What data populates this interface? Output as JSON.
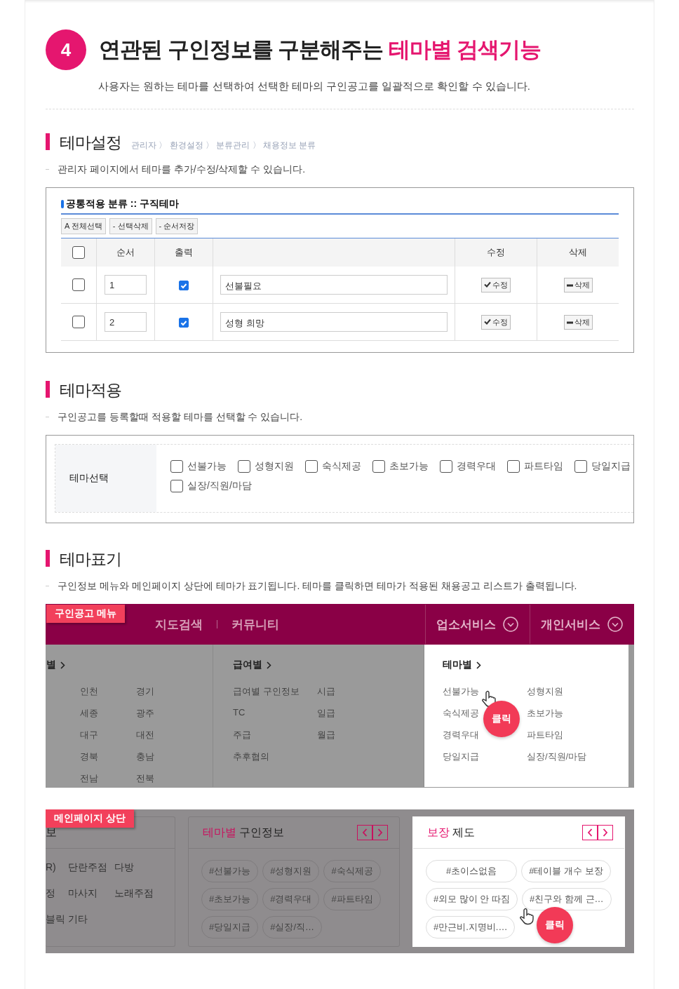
{
  "header": {
    "number": "4",
    "title": "연관된 구인정보를 구분해주는",
    "title_highlight": "테마별 검색기능",
    "subtitle": "사용자는 원하는 테마를 선택하여 선택한 테마의 구인공고를 일괄적으로 확인할 수 있습니다."
  },
  "sections": [
    {
      "kind": "admin",
      "title": "테마설정",
      "breadcrumb": "관리자 〉 환경설정 〉 분류관리 〉 채용정보 분류",
      "description": "관리자 페이지에서 테마를 추가/수정/삭제할 수 있습니다.",
      "panel": {
        "title": "공통적용 분류 :: 구직테마",
        "buttons": [
          "A 전체선택",
          "- 선택삭제",
          "- 순서저장"
        ],
        "header_checked": false,
        "columns": [
          "순서",
          "출력",
          "수정",
          "삭제"
        ],
        "rows": [
          {
            "checked": false,
            "order": "1",
            "output": true,
            "name": "선불필요",
            "edit": "수정",
            "delete": "삭제"
          },
          {
            "checked": false,
            "order": "2",
            "output": true,
            "name": "성형 희망",
            "edit": "수정",
            "delete": "삭제"
          }
        ]
      }
    },
    {
      "kind": "themes",
      "title": "테마적용",
      "description": "구인공고를 등록할때 적용할 테마를 선택할 수 있습니다.",
      "panel": {
        "label": "테마선택",
        "options": [
          {
            "label": "선불가능",
            "checked": false
          },
          {
            "label": "성형지원",
            "checked": false
          },
          {
            "label": "숙식제공",
            "checked": false
          },
          {
            "label": "초보가능",
            "checked": false
          },
          {
            "label": "경력우대",
            "checked": false
          },
          {
            "label": "파트타임",
            "checked": false
          },
          {
            "label": "당일지급",
            "checked": false
          },
          {
            "label": "실장/직원/마담",
            "checked": false
          }
        ]
      }
    },
    {
      "kind": "display",
      "title": "테마표기",
      "description": "구인정보 메뉴와 메인페이지 상단에 테마가 표기됩니다. 테마를 클릭하면 테마가 적용된 채용공고 리스트가 출력됩니다.",
      "menu": {
        "badge": "구인공고 메뉴",
        "nav_left": [
          "지도검색",
          "커뮤니티"
        ],
        "nav_right": [
          "업소서비스",
          "개인서비스"
        ],
        "click": "클릭",
        "columns": [
          {
            "heading": "별",
            "selected": false,
            "items": [
              "인천",
              "경기",
              "세종",
              "광주",
              "대구",
              "대전",
              "경북",
              "충남",
              "전남",
              "전북"
            ]
          },
          {
            "heading": "급여별",
            "selected": false,
            "items": [
              "급여별 구인정보",
              "시급",
              "TC",
              "일급",
              "주급",
              "월급",
              "추후협의"
            ]
          },
          {
            "heading": "테마별",
            "selected": true,
            "items": [
              "선불가능",
              "성형지원",
              "숙식제공",
              "초보가능",
              "경력우대",
              "파트타임",
              "당일지급",
              "실장/직원/마담"
            ]
          }
        ]
      },
      "main": {
        "badge": "메인페이지 상단",
        "click": "클릭",
        "left_card": {
          "title": "보",
          "rows": [
            [
              "R)",
              "단란주점",
              "다방"
            ],
            [
              "정",
              "마사지",
              "노래주점"
            ],
            [
              "블릭",
              "기타"
            ]
          ]
        },
        "cards": [
          {
            "title_highlight": "테마별",
            "title": "구인정보",
            "selected": false,
            "tags": [
              "#선불가능",
              "#성형지원",
              "#숙식제공",
              "#초보가능",
              "#경력우대",
              "#파트타임",
              "#당일지급",
              "#실장/직…"
            ]
          },
          {
            "title_highlight": "보장",
            "title": "제도",
            "selected": true,
            "tags": [
              "#초이스없음",
              "#테이블 개수 보장",
              "#외모 많이 안 따짐",
              "#친구와 함께 근…",
              "#만근비.지명비.…"
            ]
          }
        ]
      }
    }
  ]
}
